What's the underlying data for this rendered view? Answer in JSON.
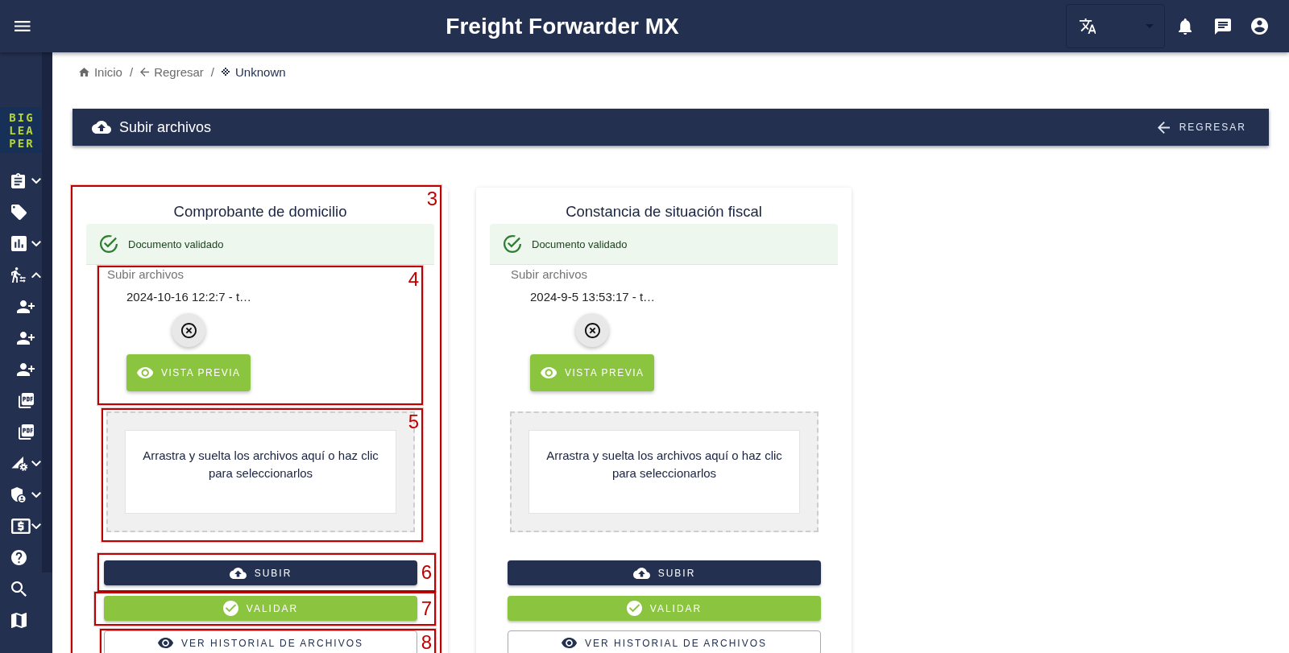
{
  "topbar": {
    "title": "Freight Forwarder MX"
  },
  "sidebar": {
    "logo": [
      "BIG",
      "LEA",
      "PER"
    ],
    "items": [
      {
        "kind": "group",
        "expanded": false
      },
      {
        "kind": "link"
      },
      {
        "kind": "group",
        "expanded": false
      },
      {
        "kind": "group",
        "expanded": true,
        "children": [
          {
            "kind": "link"
          },
          {
            "kind": "link"
          },
          {
            "kind": "link"
          },
          {
            "kind": "link"
          },
          {
            "kind": "link"
          }
        ]
      },
      {
        "kind": "group",
        "expanded": false
      },
      {
        "kind": "group",
        "expanded": false
      },
      {
        "kind": "group",
        "expanded": false
      },
      {
        "kind": "link"
      },
      {
        "kind": "link"
      },
      {
        "kind": "link"
      }
    ]
  },
  "breadcrumb": {
    "items": [
      {
        "label": "Inicio",
        "current": false
      },
      {
        "label": "Regresar",
        "separator": "/",
        "current": false
      },
      {
        "label": "Unknown",
        "separator": "/",
        "current": true
      }
    ]
  },
  "header": {
    "title": "Subir archivos",
    "back_button": "REGRESAR"
  },
  "cards": [
    {
      "annotation": "3",
      "title": "Comprobante de domicilio",
      "alert": {
        "kind": "success",
        "text": "Documento validado"
      },
      "upload": {
        "annotation": "4",
        "label": "Subir archivos",
        "file_name": "2024-10-16 12:2:7 - t…",
        "preview_button": "VISTA PREVIA"
      },
      "dropzone": {
        "annotation": "5",
        "text": "Arrastra y suelta los archivos aquí o haz clic para seleccionarlos"
      },
      "buttons": [
        {
          "kind": "primary",
          "label": "SUBIR",
          "annotation": "6"
        },
        {
          "kind": "success",
          "label": "VALIDAR",
          "annotation": "7"
        },
        {
          "kind": "outlined",
          "label": "VER HISTORIAL DE ARCHIVOS",
          "annotation": "8"
        }
      ]
    },
    {
      "title": "Constancia de situación fiscal",
      "alert": {
        "kind": "success",
        "text": "Documento validado"
      },
      "upload": {
        "label": "Subir archivos",
        "file_name": "2024-9-5 13:53:17 - t…",
        "preview_button": "VISTA PREVIA"
      },
      "dropzone": {
        "text": "Arrastra y suelta los archivos aquí o haz clic para seleccionarlos"
      },
      "buttons": [
        {
          "kind": "primary",
          "label": "SUBIR"
        },
        {
          "kind": "success",
          "label": "VALIDAR"
        },
        {
          "kind": "outlined",
          "label": "VER HISTORIAL DE ARCHIVOS"
        }
      ]
    }
  ]
}
